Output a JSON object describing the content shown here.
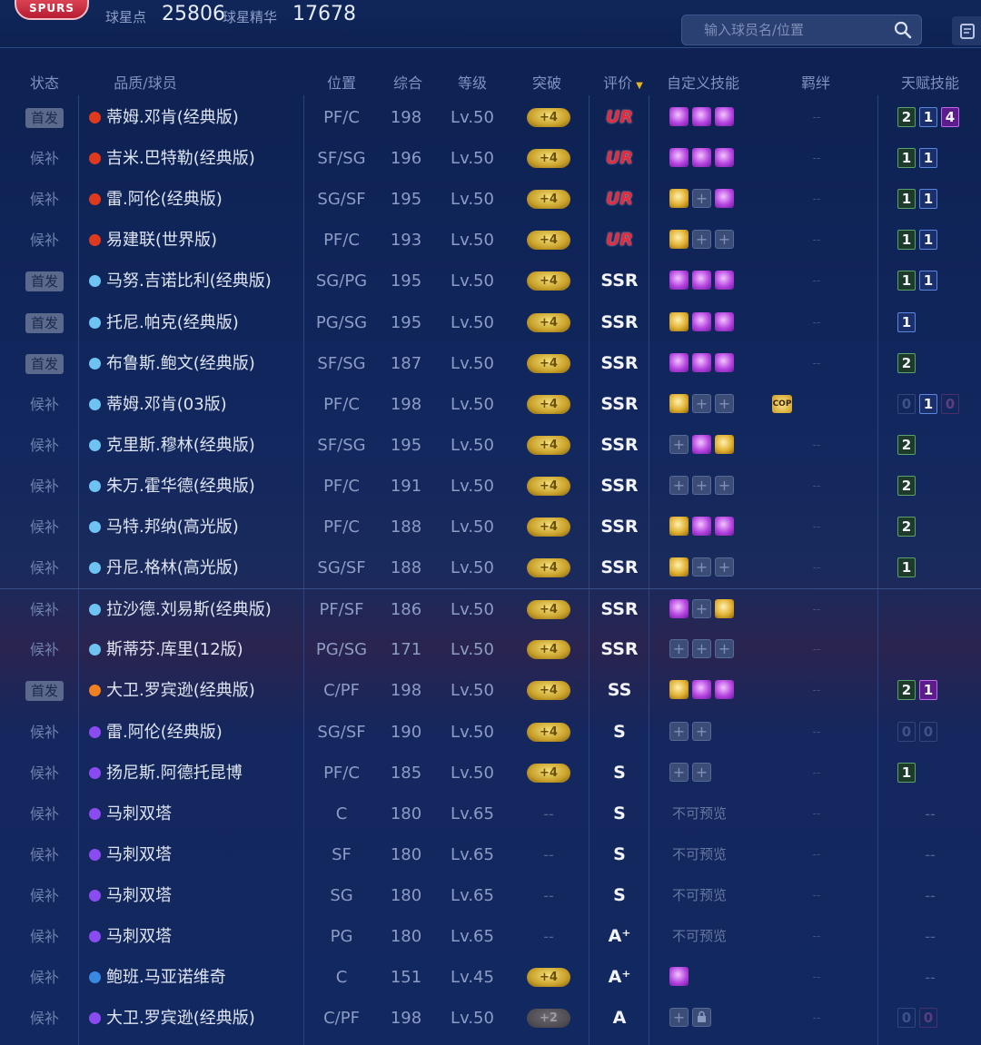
{
  "topbar": {
    "logo_text": "SPURS",
    "currency1_label": "球星点",
    "currency1_value": "25806",
    "currency2_label": "球星精华",
    "currency2_value": "17678",
    "search_placeholder": "输入球员名/位置",
    "search_icon": "search-icon",
    "corner_icon": "document-icon"
  },
  "colors": {
    "rarity_red": "#e03a1e",
    "rarity_lightblue": "#6fc3f2",
    "rarity_orange": "#f08020",
    "rarity_purple": "#8a4cf0",
    "rarity_blue": "#3a88e0",
    "rate_UR": "#e8283c",
    "breakthrough_gold": "#e0b030"
  },
  "header": {
    "status": "状态",
    "player": "品质/球员",
    "position": "位置",
    "overall": "综合",
    "level": "等级",
    "breakthrough": "突破",
    "rating": "评价",
    "custom_skills": "自定义技能",
    "bond": "羁绊",
    "talents": "天赋技能"
  },
  "rows": [
    {
      "status": "首发",
      "starter": true,
      "rarity": "red",
      "name": "蒂姆.邓肯(经典版)",
      "pos": "PF/C",
      "ovr": "198",
      "lvl": "Lv.50",
      "brk": "+4",
      "rate": "UR",
      "skills": [
        "purple",
        "purple",
        "purple"
      ],
      "bond": "--",
      "talents": [
        [
          "2",
          "green"
        ],
        [
          "1",
          "blue"
        ],
        [
          "4",
          "purple"
        ]
      ]
    },
    {
      "status": "候补",
      "starter": false,
      "rarity": "red",
      "name": "吉米.巴特勒(经典版)",
      "pos": "SF/SG",
      "ovr": "196",
      "lvl": "Lv.50",
      "brk": "+4",
      "rate": "UR",
      "skills": [
        "purple",
        "purple",
        "purple"
      ],
      "bond": "--",
      "talents": [
        [
          "1",
          "green"
        ],
        [
          "1",
          "blue"
        ]
      ]
    },
    {
      "status": "候补",
      "starter": false,
      "rarity": "red",
      "name": "雷.阿伦(经典版)",
      "pos": "SG/SF",
      "ovr": "195",
      "lvl": "Lv.50",
      "brk": "+4",
      "rate": "UR",
      "skills": [
        "gold",
        "empty",
        "purple"
      ],
      "bond": "--",
      "talents": [
        [
          "1",
          "green"
        ],
        [
          "1",
          "blue"
        ]
      ]
    },
    {
      "status": "候补",
      "starter": false,
      "rarity": "red",
      "name": "易建联(世界版)",
      "pos": "PF/C",
      "ovr": "193",
      "lvl": "Lv.50",
      "brk": "+4",
      "rate": "UR",
      "skills": [
        "gold",
        "empty",
        "empty"
      ],
      "bond": "--",
      "talents": [
        [
          "1",
          "green"
        ],
        [
          "1",
          "blue"
        ]
      ]
    },
    {
      "status": "首发",
      "starter": true,
      "rarity": "lightblue",
      "name": "马努.吉诺比利(经典版)",
      "pos": "SG/PG",
      "ovr": "195",
      "lvl": "Lv.50",
      "brk": "+4",
      "rate": "SSR",
      "skills": [
        "purple",
        "purple",
        "purple"
      ],
      "bond": "--",
      "talents": [
        [
          "1",
          "green"
        ],
        [
          "1",
          "blue"
        ]
      ]
    },
    {
      "status": "首发",
      "starter": true,
      "rarity": "lightblue",
      "name": "托尼.帕克(经典版)",
      "pos": "PG/SG",
      "ovr": "195",
      "lvl": "Lv.50",
      "brk": "+4",
      "rate": "SSR",
      "skills": [
        "gold",
        "purple",
        "purple"
      ],
      "bond": "--",
      "talents": [
        [
          "1",
          "blue"
        ]
      ]
    },
    {
      "status": "首发",
      "starter": true,
      "rarity": "lightblue",
      "name": "布鲁斯.鲍文(经典版)",
      "pos": "SF/SG",
      "ovr": "187",
      "lvl": "Lv.50",
      "brk": "+4",
      "rate": "SSR",
      "skills": [
        "purple",
        "purple",
        "purple"
      ],
      "bond": "--",
      "talents": [
        [
          "2",
          "green"
        ]
      ]
    },
    {
      "status": "候补",
      "starter": false,
      "rarity": "lightblue",
      "name": "蒂姆.邓肯(03版)",
      "pos": "PF/C",
      "ovr": "198",
      "lvl": "Lv.50",
      "brk": "+4",
      "rate": "SSR",
      "skills": [
        "gold",
        "empty",
        "empty"
      ],
      "bond": "COP",
      "talents": [
        [
          "0",
          "ghost"
        ],
        [
          "1",
          "blue"
        ],
        [
          "0",
          "ghostp"
        ]
      ]
    },
    {
      "status": "候补",
      "starter": false,
      "rarity": "lightblue",
      "name": "克里斯.穆林(经典版)",
      "pos": "SF/SG",
      "ovr": "195",
      "lvl": "Lv.50",
      "brk": "+4",
      "rate": "SSR",
      "skills": [
        "empty",
        "purple",
        "gold"
      ],
      "bond": "--",
      "talents": [
        [
          "2",
          "green"
        ]
      ]
    },
    {
      "status": "候补",
      "starter": false,
      "rarity": "lightblue",
      "name": "朱万.霍华德(经典版)",
      "pos": "PF/C",
      "ovr": "191",
      "lvl": "Lv.50",
      "brk": "+4",
      "rate": "SSR",
      "skills": [
        "empty",
        "empty",
        "empty"
      ],
      "bond": "--",
      "talents": [
        [
          "2",
          "green"
        ]
      ]
    },
    {
      "status": "候补",
      "starter": false,
      "rarity": "lightblue",
      "name": "马特.邦纳(高光版)",
      "pos": "PF/C",
      "ovr": "188",
      "lvl": "Lv.50",
      "brk": "+4",
      "rate": "SSR",
      "skills": [
        "gold",
        "purple",
        "purple"
      ],
      "bond": "--",
      "talents": [
        [
          "2",
          "green"
        ]
      ]
    },
    {
      "status": "候补",
      "starter": false,
      "rarity": "lightblue",
      "name": "丹尼.格林(高光版)",
      "pos": "SG/SF",
      "ovr": "188",
      "lvl": "Lv.50",
      "brk": "+4",
      "rate": "SSR",
      "skills": [
        "gold",
        "empty",
        "empty"
      ],
      "bond": "--",
      "talents": [
        [
          "1",
          "green"
        ]
      ]
    },
    {
      "status": "候补",
      "starter": false,
      "rarity": "lightblue",
      "name": "拉沙德.刘易斯(经典版)",
      "pos": "PF/SF",
      "ovr": "186",
      "lvl": "Lv.50",
      "brk": "+4",
      "rate": "SSR",
      "skills": [
        "purple",
        "empty",
        "gold"
      ],
      "bond": "--",
      "talents": []
    },
    {
      "status": "候补",
      "starter": false,
      "rarity": "lightblue",
      "name": "斯蒂芬.库里(12版)",
      "pos": "PG/SG",
      "ovr": "171",
      "lvl": "Lv.50",
      "brk": "+4",
      "rate": "SSR",
      "skills": [
        "empty",
        "empty",
        "empty"
      ],
      "bond": "--",
      "talents": []
    },
    {
      "status": "首发",
      "starter": true,
      "rarity": "orange",
      "name": "大卫.罗宾逊(经典版)",
      "pos": "C/PF",
      "ovr": "198",
      "lvl": "Lv.50",
      "brk": "+4",
      "rate": "SS",
      "skills": [
        "gold",
        "purple",
        "purple"
      ],
      "bond": "--",
      "talents": [
        [
          "2",
          "green"
        ],
        [
          "1",
          "purple"
        ]
      ]
    },
    {
      "status": "候补",
      "starter": false,
      "rarity": "purple",
      "name": "雷.阿伦(经典版)",
      "pos": "SG/SF",
      "ovr": "190",
      "lvl": "Lv.50",
      "brk": "+4",
      "rate": "S",
      "skills": [
        "empty",
        "empty"
      ],
      "bond": "--",
      "talents": [
        [
          "0",
          "ghost"
        ],
        [
          "0",
          "ghost"
        ]
      ]
    },
    {
      "status": "候补",
      "starter": false,
      "rarity": "purple",
      "name": "扬尼斯.阿德托昆博",
      "pos": "PF/C",
      "ovr": "185",
      "lvl": "Lv.50",
      "brk": "+4",
      "rate": "S",
      "skills": [
        "empty",
        "empty"
      ],
      "bond": "--",
      "talents": [
        [
          "1",
          "green"
        ]
      ]
    },
    {
      "status": "候补",
      "starter": false,
      "rarity": "purple",
      "name": "马刺双塔",
      "pos": "C",
      "ovr": "180",
      "lvl": "Lv.65",
      "brk": "--",
      "rate": "S",
      "noprev": "不可预览",
      "bond": "--",
      "talent_text": "--"
    },
    {
      "status": "候补",
      "starter": false,
      "rarity": "purple",
      "name": "马刺双塔",
      "pos": "SF",
      "ovr": "180",
      "lvl": "Lv.65",
      "brk": "--",
      "rate": "S",
      "noprev": "不可预览",
      "bond": "--",
      "talent_text": "--"
    },
    {
      "status": "候补",
      "starter": false,
      "rarity": "purple",
      "name": "马刺双塔",
      "pos": "SG",
      "ovr": "180",
      "lvl": "Lv.65",
      "brk": "--",
      "rate": "S",
      "noprev": "不可预览",
      "bond": "--",
      "talent_text": "--"
    },
    {
      "status": "候补",
      "starter": false,
      "rarity": "purple",
      "name": "马刺双塔",
      "pos": "PG",
      "ovr": "180",
      "lvl": "Lv.65",
      "brk": "--",
      "rate": "A⁺",
      "noprev": "不可预览",
      "bond": "--",
      "talent_text": "--"
    },
    {
      "status": "候补",
      "starter": false,
      "rarity": "blue",
      "name": "鲍班.马亚诺维奇",
      "pos": "C",
      "ovr": "151",
      "lvl": "Lv.45",
      "brk": "+4",
      "rate": "A⁺",
      "skills": [
        "purple"
      ],
      "bond": "--",
      "talent_text": "--"
    },
    {
      "status": "候补",
      "starter": false,
      "rarity": "purple",
      "name": "大卫.罗宾逊(经典版)",
      "pos": "C/PF",
      "ovr": "198",
      "lvl": "Lv.50",
      "brk": "+2",
      "brk_dim": true,
      "rate": "A",
      "skills": [
        "empty",
        "lock"
      ],
      "bond": "--",
      "talents": [
        [
          "0",
          "ghost"
        ],
        [
          "0",
          "ghostp"
        ]
      ]
    }
  ]
}
